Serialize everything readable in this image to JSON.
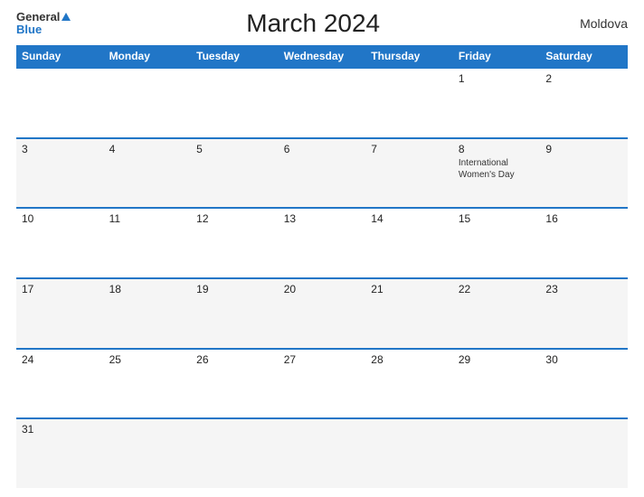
{
  "header": {
    "logo_general": "General",
    "logo_blue": "Blue",
    "title": "March 2024",
    "country": "Moldova"
  },
  "calendar": {
    "weekdays": [
      "Sunday",
      "Monday",
      "Tuesday",
      "Wednesday",
      "Thursday",
      "Friday",
      "Saturday"
    ],
    "rows": [
      [
        {
          "day": "",
          "holiday": "",
          "shaded": false
        },
        {
          "day": "",
          "holiday": "",
          "shaded": false
        },
        {
          "day": "",
          "holiday": "",
          "shaded": false
        },
        {
          "day": "",
          "holiday": "",
          "shaded": false
        },
        {
          "day": "",
          "holiday": "",
          "shaded": false
        },
        {
          "day": "1",
          "holiday": "",
          "shaded": false
        },
        {
          "day": "2",
          "holiday": "",
          "shaded": false
        }
      ],
      [
        {
          "day": "3",
          "holiday": "",
          "shaded": false
        },
        {
          "day": "4",
          "holiday": "",
          "shaded": false
        },
        {
          "day": "5",
          "holiday": "",
          "shaded": false
        },
        {
          "day": "6",
          "holiday": "",
          "shaded": false
        },
        {
          "day": "7",
          "holiday": "",
          "shaded": false
        },
        {
          "day": "8",
          "holiday": "International Women's Day",
          "shaded": false
        },
        {
          "day": "9",
          "holiday": "",
          "shaded": false
        }
      ],
      [
        {
          "day": "10",
          "holiday": "",
          "shaded": false
        },
        {
          "day": "11",
          "holiday": "",
          "shaded": false
        },
        {
          "day": "12",
          "holiday": "",
          "shaded": false
        },
        {
          "day": "13",
          "holiday": "",
          "shaded": false
        },
        {
          "day": "14",
          "holiday": "",
          "shaded": false
        },
        {
          "day": "15",
          "holiday": "",
          "shaded": false
        },
        {
          "day": "16",
          "holiday": "",
          "shaded": false
        }
      ],
      [
        {
          "day": "17",
          "holiday": "",
          "shaded": false
        },
        {
          "day": "18",
          "holiday": "",
          "shaded": false
        },
        {
          "day": "19",
          "holiday": "",
          "shaded": false
        },
        {
          "day": "20",
          "holiday": "",
          "shaded": false
        },
        {
          "day": "21",
          "holiday": "",
          "shaded": false
        },
        {
          "day": "22",
          "holiday": "",
          "shaded": false
        },
        {
          "day": "23",
          "holiday": "",
          "shaded": false
        }
      ],
      [
        {
          "day": "24",
          "holiday": "",
          "shaded": false
        },
        {
          "day": "25",
          "holiday": "",
          "shaded": false
        },
        {
          "day": "26",
          "holiday": "",
          "shaded": false
        },
        {
          "day": "27",
          "holiday": "",
          "shaded": false
        },
        {
          "day": "28",
          "holiday": "",
          "shaded": false
        },
        {
          "day": "29",
          "holiday": "",
          "shaded": false
        },
        {
          "day": "30",
          "holiday": "",
          "shaded": false
        }
      ],
      [
        {
          "day": "31",
          "holiday": "",
          "shaded": false
        },
        {
          "day": "",
          "holiday": "",
          "shaded": false
        },
        {
          "day": "",
          "holiday": "",
          "shaded": false
        },
        {
          "day": "",
          "holiday": "",
          "shaded": false
        },
        {
          "day": "",
          "holiday": "",
          "shaded": false
        },
        {
          "day": "",
          "holiday": "",
          "shaded": false
        },
        {
          "day": "",
          "holiday": "",
          "shaded": false
        }
      ]
    ]
  }
}
